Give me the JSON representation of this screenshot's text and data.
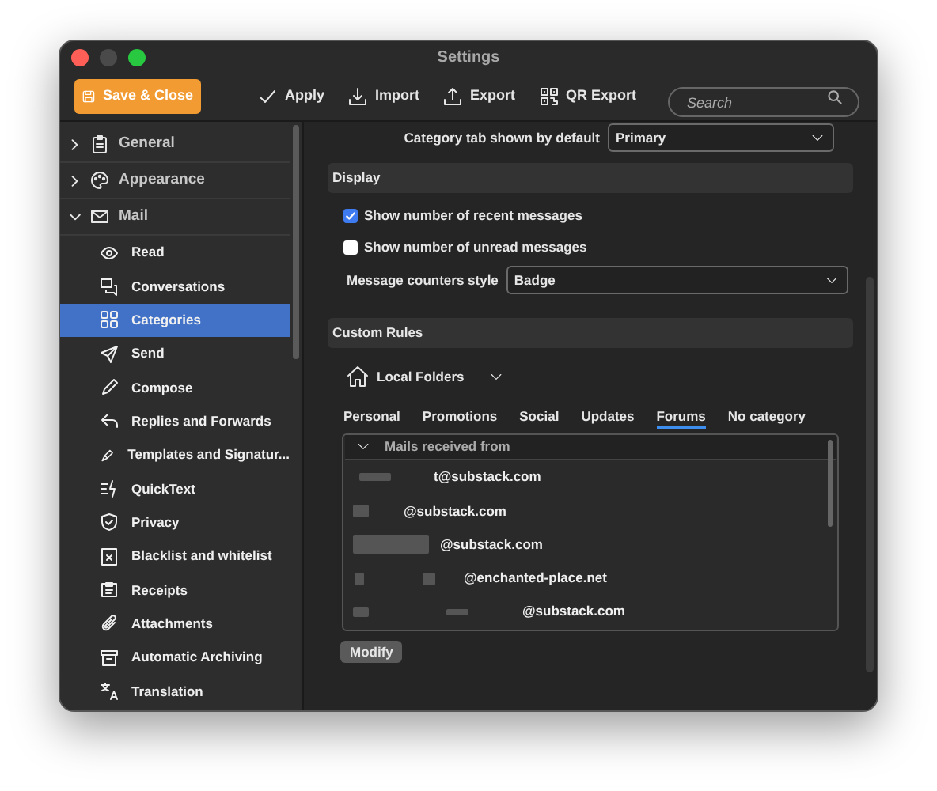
{
  "window": {
    "title": "Settings"
  },
  "toolbar": {
    "save_button": "Save & Close",
    "actions": [
      "Apply",
      "Import",
      "Export",
      "QR Export"
    ],
    "search": {
      "placeholder": "Search"
    }
  },
  "sidebar": {
    "items": [
      {
        "label": "General",
        "expanded": false,
        "selected": false
      },
      {
        "label": "Appearance",
        "expanded": false,
        "selected": false
      },
      {
        "label": "Mail",
        "expanded": true,
        "selected": false,
        "children": [
          {
            "label": "Read",
            "selected": false
          },
          {
            "label": "Conversations",
            "selected": false
          },
          {
            "label": "Categories",
            "selected": true
          },
          {
            "label": "Send",
            "selected": false
          },
          {
            "label": "Compose",
            "selected": false
          },
          {
            "label": "Replies and Forwards",
            "selected": false
          },
          {
            "label": "Templates and Signatur...",
            "selected": false
          },
          {
            "label": "QuickText",
            "selected": false
          },
          {
            "label": "Privacy",
            "selected": false
          },
          {
            "label": "Blacklist and whitelist",
            "selected": false
          },
          {
            "label": "Receipts",
            "selected": false
          },
          {
            "label": "Attachments",
            "selected": false
          },
          {
            "label": "Automatic Archiving",
            "selected": false
          },
          {
            "label": "Translation",
            "selected": false
          }
        ]
      }
    ]
  },
  "content": {
    "default_tab": {
      "label": "Category tab shown by default",
      "value": "Primary"
    },
    "display": {
      "title": "Display",
      "checkboxes": [
        {
          "label": "Show number of recent messages",
          "checked": true
        },
        {
          "label": "Show number of unread messages",
          "checked": false
        }
      ],
      "counters_style": {
        "label": "Message counters style",
        "value": "Badge"
      }
    },
    "custom_rules": {
      "title": "Custom Rules",
      "folder": "Local Folders",
      "tabs": [
        {
          "label": "Personal",
          "selected": false
        },
        {
          "label": "Promotions",
          "selected": false
        },
        {
          "label": "Social",
          "selected": false
        },
        {
          "label": "Updates",
          "selected": false
        },
        {
          "label": "Forums",
          "selected": true
        },
        {
          "label": "No category",
          "selected": false
        }
      ],
      "list": {
        "header": "Mails received from",
        "rows": [
          "t@substack.com",
          "@substack.com",
          "@substack.com",
          "@enchanted-place.net",
          "@substack.com"
        ]
      },
      "modify_button": "Modify"
    }
  }
}
